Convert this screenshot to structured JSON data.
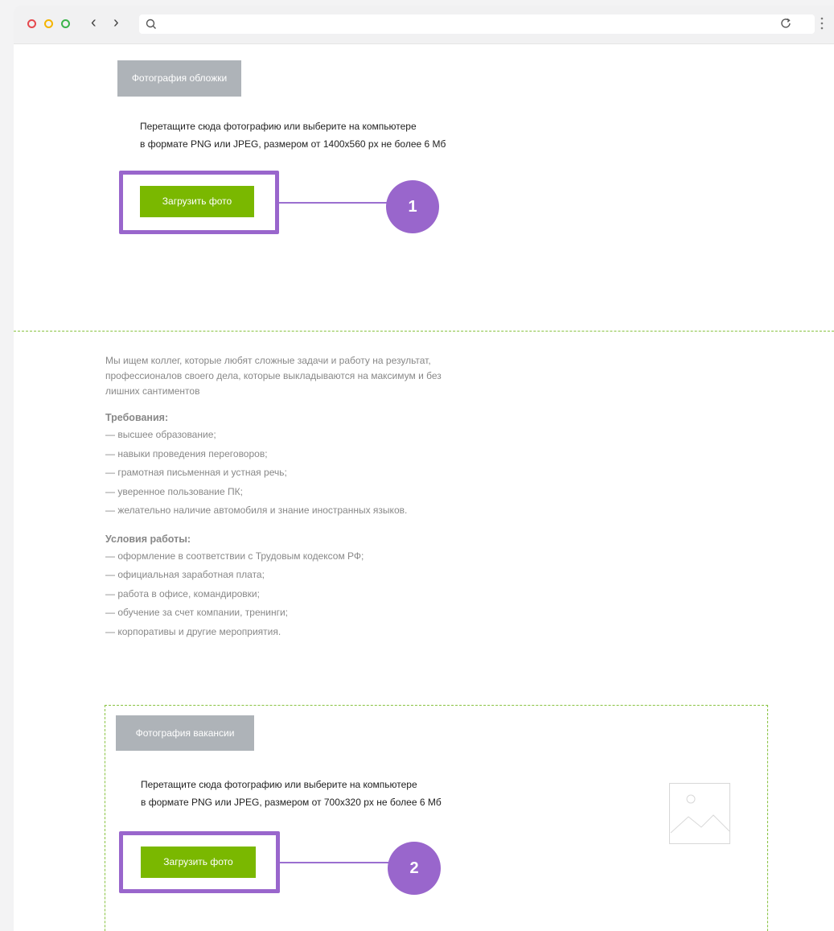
{
  "browser": {
    "url": ""
  },
  "cover": {
    "tab_label": "Фотография обложки",
    "hint_line1": "Перетащите сюда фотографию или выберите на компьютере",
    "hint_line2": "в формате PNG или JPEG, размером от 1400x560 px не более 6 Мб",
    "button_label": "Загрузить фото",
    "badge": "1"
  },
  "description": {
    "intro_line1": "Мы ищем коллег, которые любят сложные задачи и работу на результат,",
    "intro_line2": "профессионалов своего дела, которые выкладываются на максимум и без",
    "intro_line3": "лишних сантиментов",
    "requirements_title": "Требования:",
    "requirements": [
      "— высшее образование;",
      "— навыки проведения переговоров;",
      "— грамотная письменная и устная речь;",
      "— уверенное пользование ПК;",
      "— желательно наличие автомобиля и знание иностранных языков."
    ],
    "conditions_title": "Условия работы:",
    "conditions": [
      "— оформление в соответствии с Трудовым кодексом РФ;",
      "— официальная заработная плата;",
      "— работа в офисе, командировки;",
      "— обучение за счет компании, тренинги;",
      "— корпоративы и другие мероприятия."
    ]
  },
  "vacancy_photo": {
    "tab_label": "Фотография вакансии",
    "hint_line1": "Перетащите сюда фотографию или выберите на компьютере",
    "hint_line2": "в формате PNG или JPEG, размером от 700x320 px не более 6 Мб",
    "button_label": "Загрузить фото",
    "badge": "2"
  },
  "colors": {
    "accent_green": "#7ab800",
    "highlight_purple": "#9966cc",
    "tab_gray": "#aeb3b8"
  }
}
